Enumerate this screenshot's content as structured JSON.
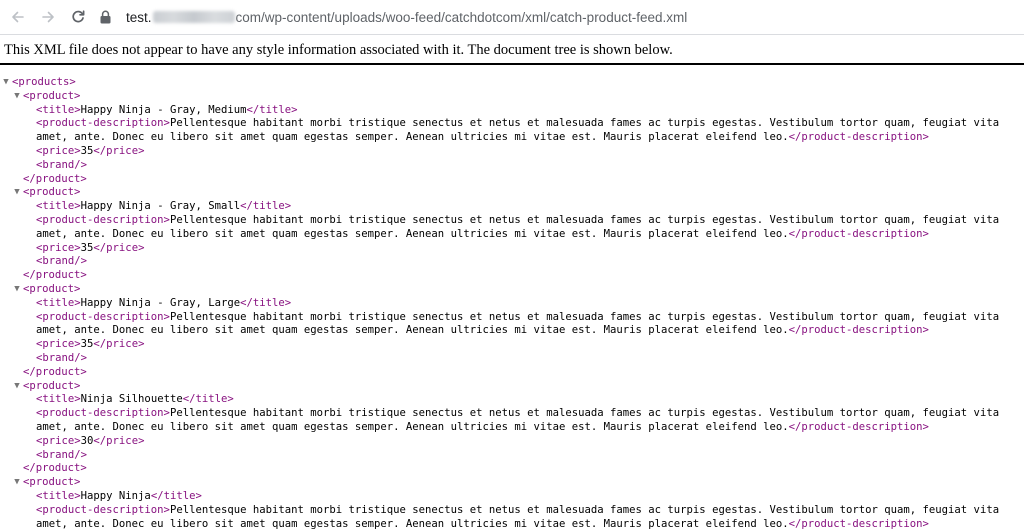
{
  "browser": {
    "url_host": "test.",
    "url_path": "com/wp-content/uploads/woo-feed/catchdotcom/xml/catch-product-feed.xml"
  },
  "xml_info": "This XML file does not appear to have any style information associated with it. The document tree is shown below.",
  "tree": {
    "root_open": "<products>",
    "product_open": "<product>",
    "product_close": "</product>",
    "title_open": "<title>",
    "title_close": "</title>",
    "desc_open": "<product-description>",
    "desc_close": "</product-description>",
    "price_open": "<price>",
    "price_close": "</price>",
    "brand": "<brand/>",
    "toggle_glyph": "▼",
    "products": [
      {
        "title": "Happy Ninja - Gray, Medium",
        "description_line1": "Pellentesque habitant morbi tristique senectus et netus et malesuada fames ac turpis egestas. Vestibulum tortor quam, feugiat vita",
        "description_line2": "amet, ante. Donec eu libero sit amet quam egestas semper. Aenean ultricies mi vitae est. Mauris placerat eleifend leo.",
        "price": "35"
      },
      {
        "title": "Happy Ninja - Gray, Small",
        "description_line1": "Pellentesque habitant morbi tristique senectus et netus et malesuada fames ac turpis egestas. Vestibulum tortor quam, feugiat vita",
        "description_line2": "amet, ante. Donec eu libero sit amet quam egestas semper. Aenean ultricies mi vitae est. Mauris placerat eleifend leo.",
        "price": "35"
      },
      {
        "title": "Happy Ninja - Gray, Large",
        "description_line1": "Pellentesque habitant morbi tristique senectus et netus et malesuada fames ac turpis egestas. Vestibulum tortor quam, feugiat vita",
        "description_line2": "amet, ante. Donec eu libero sit amet quam egestas semper. Aenean ultricies mi vitae est. Mauris placerat eleifend leo.",
        "price": "35"
      },
      {
        "title": "Ninja Silhouette",
        "description_line1": "Pellentesque habitant morbi tristique senectus et netus et malesuada fames ac turpis egestas. Vestibulum tortor quam, feugiat vita",
        "description_line2": "amet, ante. Donec eu libero sit amet quam egestas semper. Aenean ultricies mi vitae est. Mauris placerat eleifend leo.",
        "price": "30"
      },
      {
        "title": "Happy Ninja",
        "description_line1": "Pellentesque habitant morbi tristique senectus et netus et malesuada fames ac turpis egestas. Vestibulum tortor quam, feugiat vita",
        "description_line2": "amet, ante. Donec eu libero sit amet quam egestas semper. Aenean ultricies mi vitae est. Mauris placerat eleifend leo.",
        "price": ""
      }
    ]
  },
  "colors": {
    "tag": "#881280",
    "text": "#000000",
    "url_path": "#5f6368"
  }
}
